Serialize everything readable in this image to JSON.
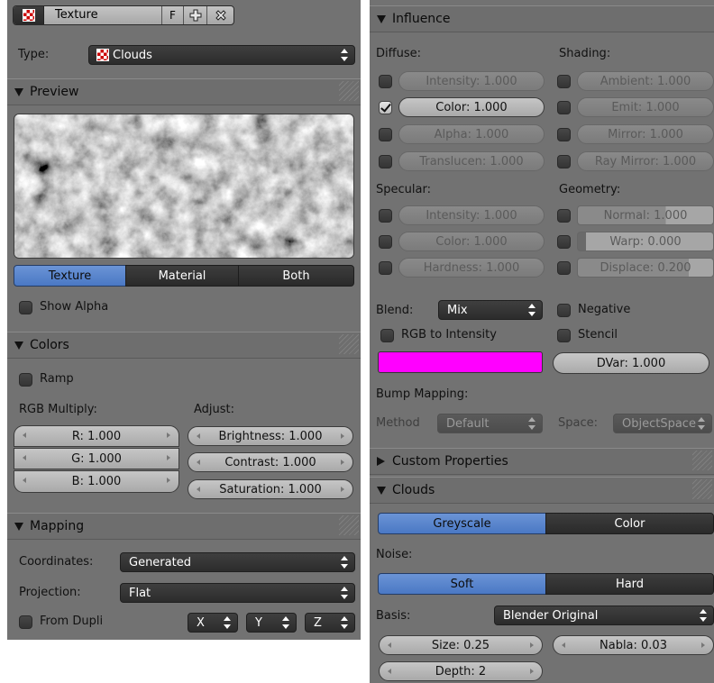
{
  "left": {
    "texture_block": {
      "name": "Texture",
      "fake_user": "F"
    },
    "type_label": "Type:",
    "type_value": "Clouds",
    "preview": {
      "header": "Preview",
      "tabs": [
        "Texture",
        "Material",
        "Both"
      ],
      "show_alpha": "Show Alpha"
    },
    "colors": {
      "header": "Colors",
      "ramp": "Ramp",
      "rgb_multiply_label": "RGB Multiply:",
      "adjust_label": "Adjust:",
      "r": "R: 1.000",
      "g": "G: 1.000",
      "b": "B: 1.000",
      "brightness": "Brightness: 1.000",
      "contrast": "Contrast: 1.000",
      "saturation": "Saturation: 1.000"
    },
    "mapping": {
      "header": "Mapping",
      "coordinates_label": "Coordinates:",
      "coordinates_value": "Generated",
      "projection_label": "Projection:",
      "projection_value": "Flat",
      "from_dupli": "From Dupli",
      "x": "X",
      "y": "Y",
      "z": "Z"
    }
  },
  "right": {
    "influence": {
      "header": "Influence",
      "diffuse_label": "Diffuse:",
      "shading_label": "Shading:",
      "diffuse": [
        {
          "text": "Intensity: 1.000",
          "checked": false
        },
        {
          "text": "Color: 1.000",
          "checked": true
        },
        {
          "text": "Alpha: 1.000",
          "checked": false
        },
        {
          "text": "Translucen: 1.000",
          "checked": false
        }
      ],
      "shading": [
        "Ambient: 1.000",
        "Emit: 1.000",
        "Mirror: 1.000",
        "Ray Mirror: 1.000"
      ],
      "specular_label": "Specular:",
      "geometry_label": "Geometry:",
      "specular": [
        "Intensity: 1.000",
        "Color: 1.000",
        "Hardness: 1.000"
      ],
      "geometry": [
        "Normal: 1.000",
        "Warp: 0.000",
        "Displace: 0.200"
      ],
      "blend_label": "Blend:",
      "blend_value": "Mix",
      "negative": "Negative",
      "rgb_to_intensity": "RGB to Intensity",
      "stencil": "Stencil",
      "color_swatch": "#ff00ff",
      "dvar": "DVar: 1.000",
      "bump_mapping_label": "Bump Mapping:",
      "method_label": "Method",
      "method_value": "Default",
      "space_label": "Space:",
      "space_value": "ObjectSpace"
    },
    "custom_properties": {
      "header": "Custom Properties"
    },
    "clouds": {
      "header": "Clouds",
      "mode": [
        "Greyscale",
        "Color"
      ],
      "noise_label": "Noise:",
      "noise": [
        "Soft",
        "Hard"
      ],
      "basis_label": "Basis:",
      "basis_value": "Blender Original",
      "size": "Size: 0.25",
      "nabla": "Nabla: 0.03",
      "depth": "Depth: 2"
    }
  },
  "colors": {
    "panel": "#727272",
    "active_button": "#5b87cf",
    "color_swatch": "#ff00ff"
  }
}
